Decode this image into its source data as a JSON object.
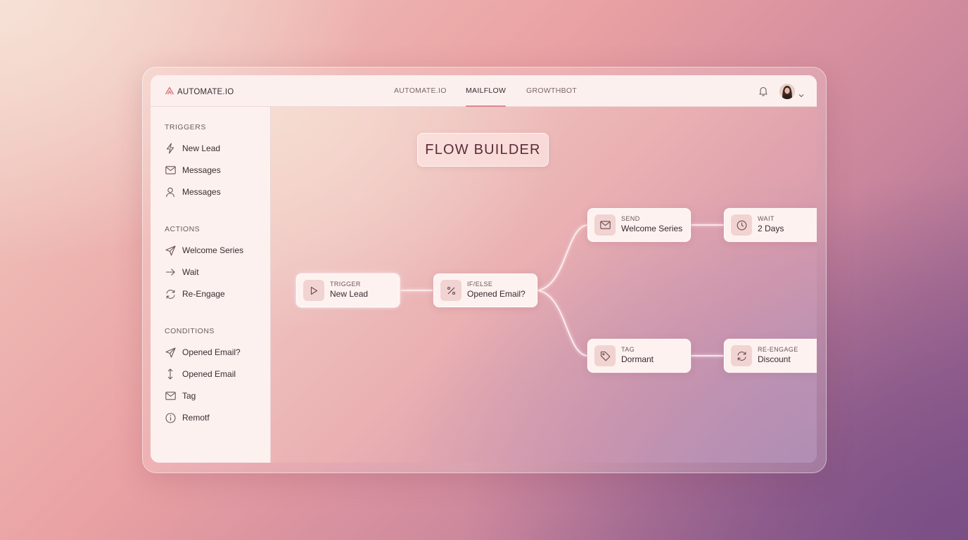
{
  "header": {
    "brand": "AUTOMATE.IO",
    "tabs": [
      {
        "label": "AUTOMATE.IO",
        "active": false
      },
      {
        "label": "MAILFLOW",
        "active": true
      },
      {
        "label": "GROWTHBOT",
        "active": false
      }
    ]
  },
  "sidebar": {
    "sections": [
      {
        "title": "TRIGGERS",
        "items": [
          {
            "label": "New Lead",
            "icon": "lightning-icon"
          },
          {
            "label": "Messages",
            "icon": "mail-icon"
          },
          {
            "label": "Messages",
            "icon": "user-icon"
          }
        ]
      },
      {
        "title": "ACTIONS",
        "items": [
          {
            "label": "Welcome Series",
            "icon": "send-icon"
          },
          {
            "label": "Wait",
            "icon": "arrow-right-icon"
          },
          {
            "label": "Re-Engage",
            "icon": "refresh-icon"
          }
        ]
      },
      {
        "title": "CONDITIONS",
        "items": [
          {
            "label": "Opened Email?",
            "icon": "send-icon"
          },
          {
            "label": "Opened Email",
            "icon": "arrow-up-down-icon"
          },
          {
            "label": "Tag",
            "icon": "mail-icon"
          },
          {
            "label": "Remotf",
            "icon": "info-icon"
          }
        ]
      }
    ]
  },
  "canvas": {
    "title": "FLOW BUILDER",
    "nodes": [
      {
        "kind": "TRIGGER",
        "label": "New Lead",
        "icon": "play-icon"
      },
      {
        "kind": "IF/ELSE",
        "label": "Opened Email?",
        "icon": "percent-icon"
      },
      {
        "kind": "SEND",
        "label": "Welcome Series",
        "icon": "mail-icon"
      },
      {
        "kind": "WAIT",
        "label": "2 Days",
        "icon": "clock-icon"
      },
      {
        "kind": "TAG",
        "label": "Dormant",
        "icon": "tag-icon"
      },
      {
        "kind": "RE-ENGAGE",
        "label": "Discount",
        "icon": "refresh-icon"
      }
    ]
  },
  "colors": {
    "accent": "#d98a8e",
    "text_dark": "#3a2830",
    "node_bg": "#fdf2f0",
    "title_text": "#5a2c38"
  }
}
